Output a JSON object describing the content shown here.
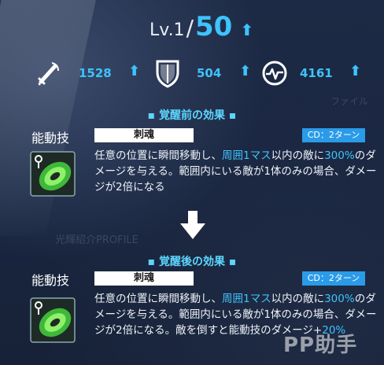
{
  "level": {
    "prefix": "Lv.1",
    "slash": "/",
    "max": "50",
    "up": "⬆"
  },
  "stats": [
    {
      "icon": "sword-icon",
      "value": "1528"
    },
    {
      "icon": "shield-icon",
      "value": "504"
    },
    {
      "icon": "heartbeat-icon",
      "value": "4161"
    }
  ],
  "before": {
    "title": "▪ 覚醒前の効果 ▪",
    "ability_label": "能動技",
    "skill_name": "刺魂",
    "cd": "CD：2ターン",
    "desc": {
      "p1": "任意の位置に瞬間移動し、",
      "h1": "周囲1マス",
      "p2": "以内の敵に",
      "h2": "300%",
      "p3": "のダメージを与える。範囲内にいる敵が1体のみの場合、ダメージが2倍になる"
    }
  },
  "after": {
    "title": "▪ 覚醒後の効果 ▪",
    "ability_label": "能動技",
    "skill_name": "刺魂",
    "cd": "CD：2ターン",
    "desc": {
      "p1": "任意の位置に瞬間移動し、",
      "h1": "周囲1マス",
      "p2": "以内の敵に",
      "h2": "300%",
      "p3": "のダメージを与える。範囲内にいる敵が1体のみの場合、ダメージが2倍になる。敵を倒すと能動技のダメージ+",
      "h3": "20%"
    }
  },
  "background_text": {
    "profile": "光輝紹介PROFILE",
    "file": "ファイル"
  },
  "watermark": "PP助手",
  "colors": {
    "accent": "#3ec3ff",
    "cd_badge": "#2a9be8",
    "section_title": "#5cd6ff"
  }
}
